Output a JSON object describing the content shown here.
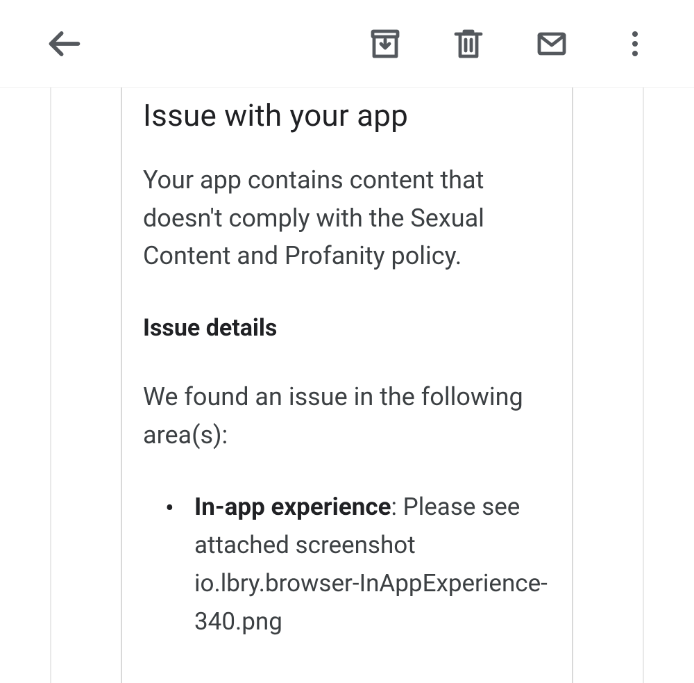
{
  "toolbar": {
    "back": "back-icon",
    "archive": "archive-icon",
    "delete": "trash-icon",
    "mail": "mail-icon",
    "more": "more-icon"
  },
  "content": {
    "heading": "Issue with your app",
    "lead": "Your app contains content that doesn't comply with the Sexual Content and Profanity policy.",
    "details_heading": "Issue details",
    "details_intro": "We found an issue in the following area(s):",
    "bullets": [
      {
        "label": "In-app experience",
        "text": ": Please see attached screenshot io.lbry.browser-InAppExperience-340.png"
      }
    ]
  }
}
